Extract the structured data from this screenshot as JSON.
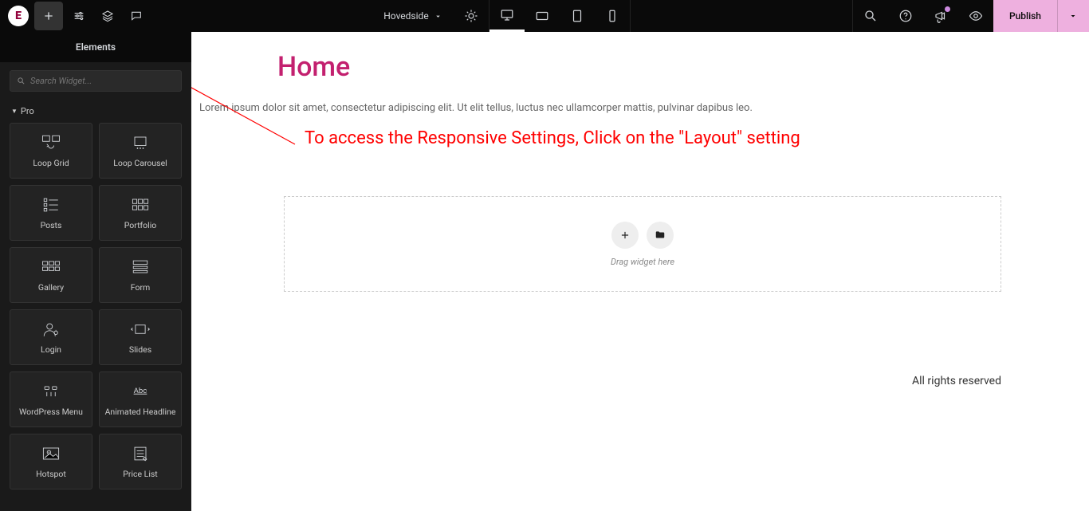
{
  "topbar": {
    "page_name": "Hovedside",
    "publish_label": "Publish"
  },
  "sidebar": {
    "title": "Elements",
    "search_placeholder": "Search Widget...",
    "section": "Pro",
    "widgets": [
      {
        "label": "Loop Grid"
      },
      {
        "label": "Loop Carousel"
      },
      {
        "label": "Posts"
      },
      {
        "label": "Portfolio"
      },
      {
        "label": "Gallery"
      },
      {
        "label": "Form"
      },
      {
        "label": "Login"
      },
      {
        "label": "Slides"
      },
      {
        "label": "WordPress Menu"
      },
      {
        "label": "Animated Headline"
      },
      {
        "label": "Hotspot"
      },
      {
        "label": "Price List"
      }
    ]
  },
  "page": {
    "title": "Home",
    "lorem": "Lorem ipsum dolor sit amet, consectetur adipiscing elit. Ut elit tellus, luctus nec ullamcorper mattis, pulvinar dapibus leo.",
    "annotation": "To access the Responsive Settings, Click on the \"Layout\" setting",
    "drop_hint": "Drag widget here",
    "footer": "All rights reserved"
  }
}
